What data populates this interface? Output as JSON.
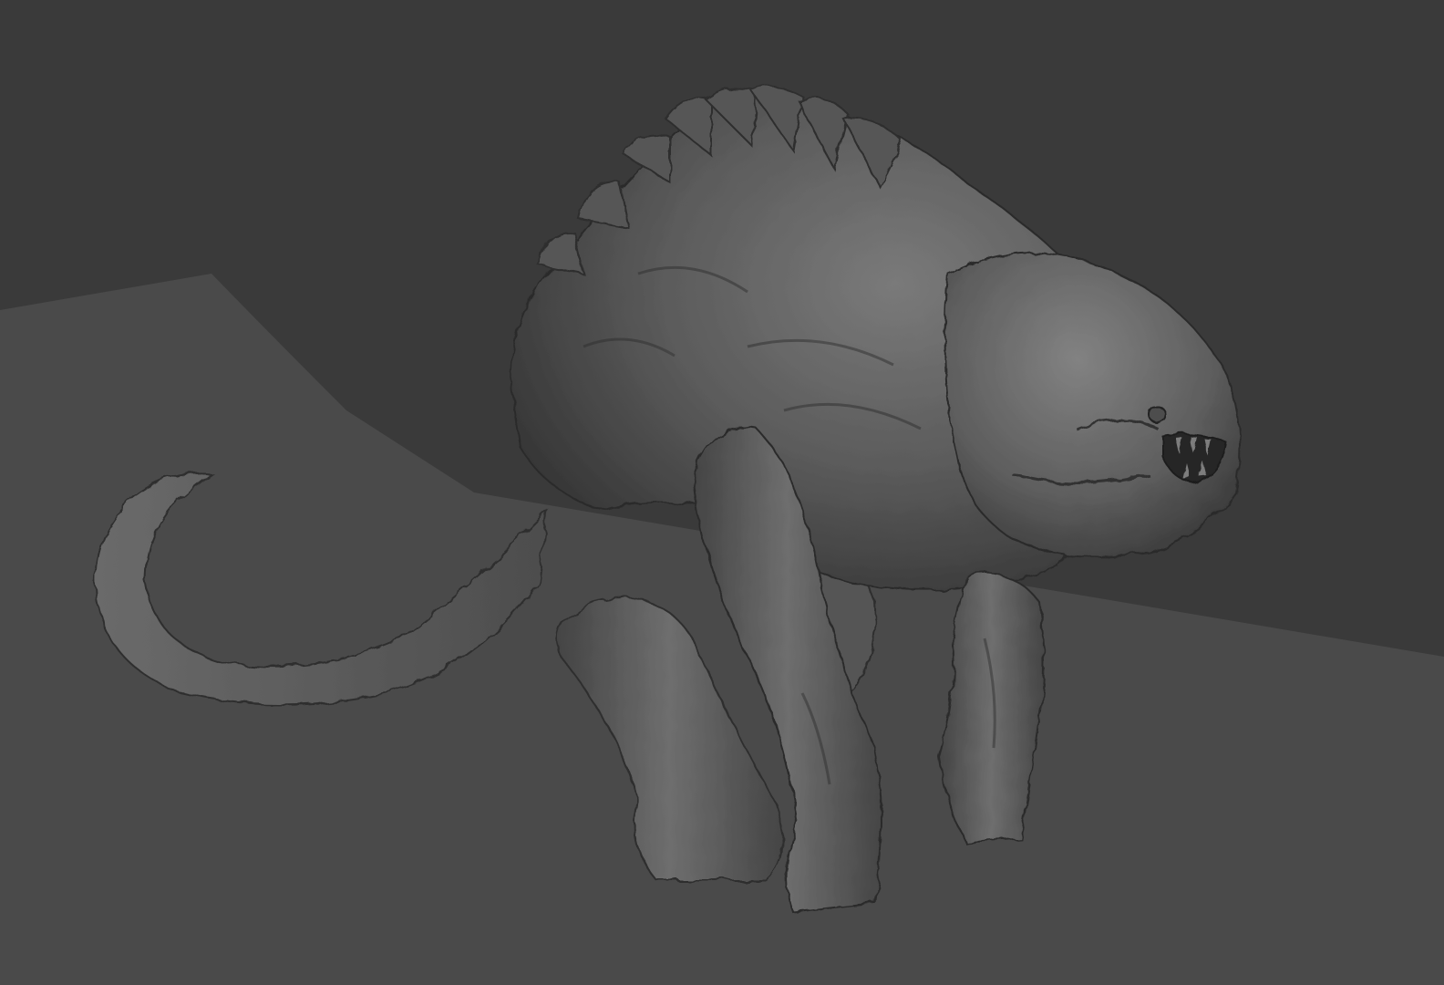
{
  "viewport": {
    "background_color": "#3a3a3a",
    "ground_plane_color": "#4a4a4a",
    "model_base_color": "#5c5c5c",
    "model_shadow_color": "#2e2e2e",
    "model_highlight_color": "#8a8a8a"
  },
  "model": {
    "icon": "creature-sculpt-icon"
  }
}
